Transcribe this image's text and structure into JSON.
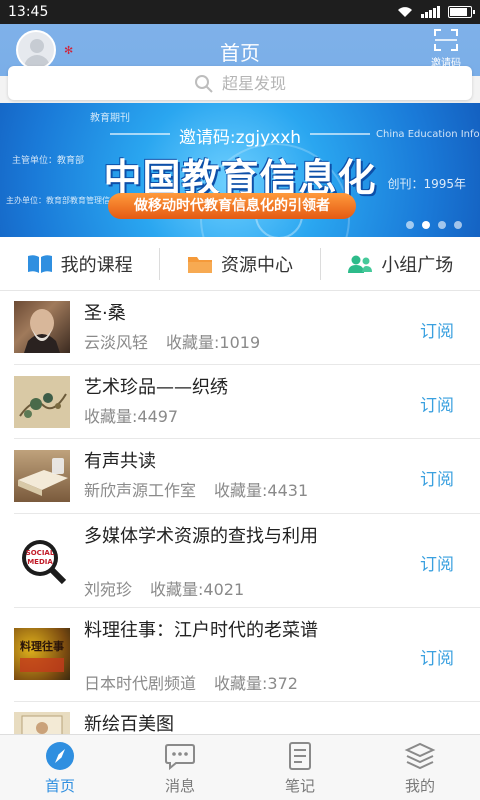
{
  "status_bar": {
    "time": "13:45"
  },
  "header": {
    "title": "首页",
    "invite_label": "邀请码"
  },
  "search": {
    "placeholder": "超星发现"
  },
  "banner": {
    "invite_code": "邀请码:zgjyxxh",
    "title": "中国教育信息化",
    "slogan": "做移动时代教育信息化的引领者",
    "magazine_tag": "教育期刊",
    "organizer": "主管单位：教育部",
    "sponsor": "主办单位：教育部教育管理信息中心",
    "english_name": "China Education Info",
    "founded": "创刊：1995年",
    "page_dots": 4,
    "active_dot": 1
  },
  "nav": [
    {
      "label": "我的课程",
      "icon": "book-icon"
    },
    {
      "label": "资源中心",
      "icon": "folder-icon"
    },
    {
      "label": "小组广场",
      "icon": "group-icon"
    }
  ],
  "list": [
    {
      "title": "圣·桑",
      "author": "云淡风轻",
      "favorites": "收藏量:1019",
      "action": "订阅"
    },
    {
      "title": "艺术珍品——织绣",
      "author": "",
      "favorites": "收藏量:4497",
      "action": "订阅"
    },
    {
      "title": "有声共读",
      "author": "新欣声源工作室",
      "favorites": "收藏量:4431",
      "action": "订阅"
    },
    {
      "title": "多媒体学术资源的查找与利用",
      "author": "刘宛珍",
      "favorites": "收藏量:4021",
      "action": "订阅",
      "thumb_text": "SOCIAL MEDIA"
    },
    {
      "title": "料理往事：江户时代的老菜谱",
      "author": "日本时代剧频道",
      "favorites": "收藏量:372",
      "action": "订阅",
      "thumb_text": "料理往事"
    },
    {
      "title": "新绘百美图",
      "author": "",
      "favorites": "",
      "action": ""
    }
  ],
  "tabs": [
    {
      "label": "首页",
      "icon": "compass-icon",
      "active": true
    },
    {
      "label": "消息",
      "icon": "chat-bubble-icon",
      "active": false
    },
    {
      "label": "笔记",
      "icon": "notebook-icon",
      "active": false
    },
    {
      "label": "我的",
      "icon": "stack-icon",
      "active": false
    }
  ],
  "colors": {
    "header": "#7aaee8",
    "accent": "#2f8fe0",
    "subscribe": "#3aa0df",
    "banner": "#1a7ad8"
  }
}
